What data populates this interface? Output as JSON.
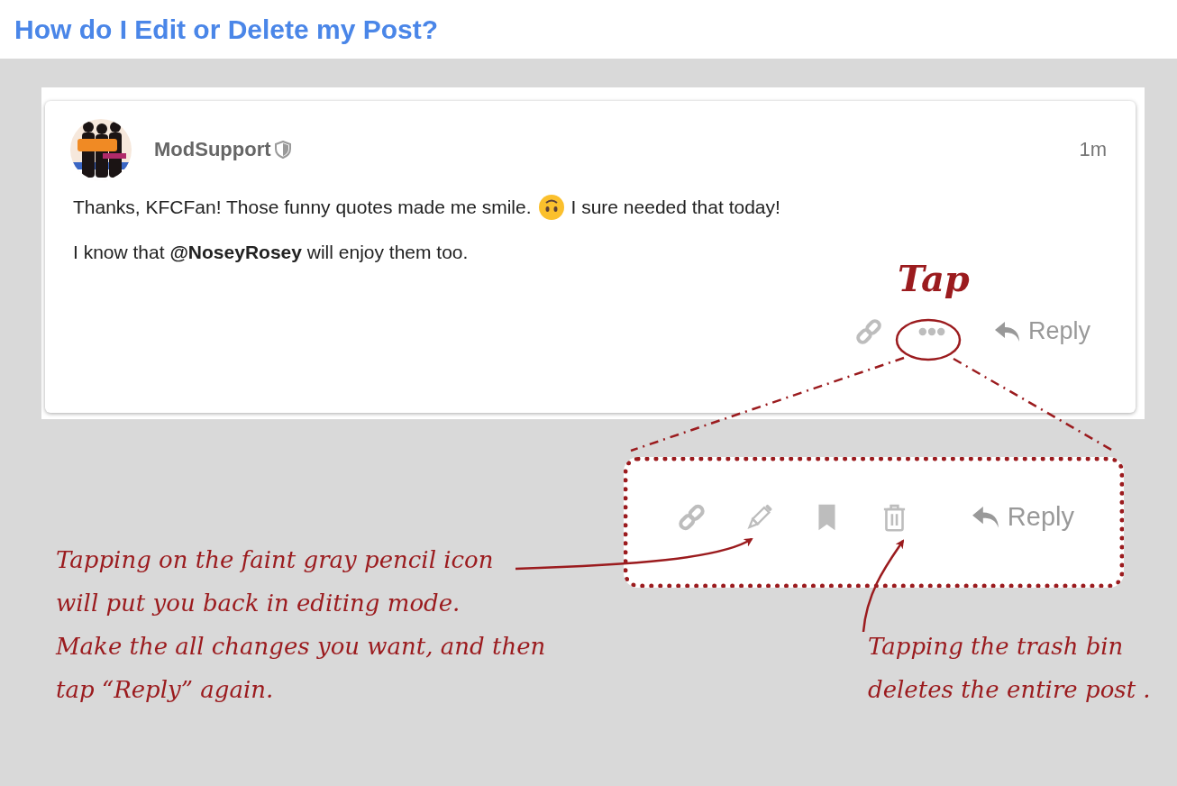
{
  "page_title": "How do I Edit or Delete my Post?",
  "post": {
    "author": "ModSupport",
    "time": "1m",
    "paragraphs": [
      {
        "parts": [
          {
            "kind": "text",
            "text": "Thanks, KFCFan! Those funny quotes made me smile."
          },
          {
            "kind": "emoji"
          },
          {
            "kind": "text",
            "text": "I sure needed that today!"
          }
        ]
      },
      {
        "parts": [
          {
            "kind": "text",
            "text": "I know that **@NoseyRosey** will enjoy them too."
          }
        ]
      }
    ],
    "actions": [
      {
        "kind": "link"
      },
      {
        "kind": "more"
      },
      {
        "kind": "reply",
        "label": "Reply"
      }
    ]
  },
  "expanded_actions": [
    {
      "kind": "link"
    },
    {
      "kind": "edit"
    },
    {
      "kind": "bookmark"
    },
    {
      "kind": "delete"
    },
    {
      "kind": "reply",
      "label": "Reply"
    }
  ],
  "tap_label": "Tap",
  "notes": [
    {
      "lines": [
        "Tapping on the faint gray pencil icon",
        "will put you back in editing mode.",
        "Make the all changes you want, and then",
        "tap “Reply” again."
      ]
    },
    {
      "lines": [
        "Tapping the trash bin",
        "deletes the entire post ."
      ]
    }
  ]
}
